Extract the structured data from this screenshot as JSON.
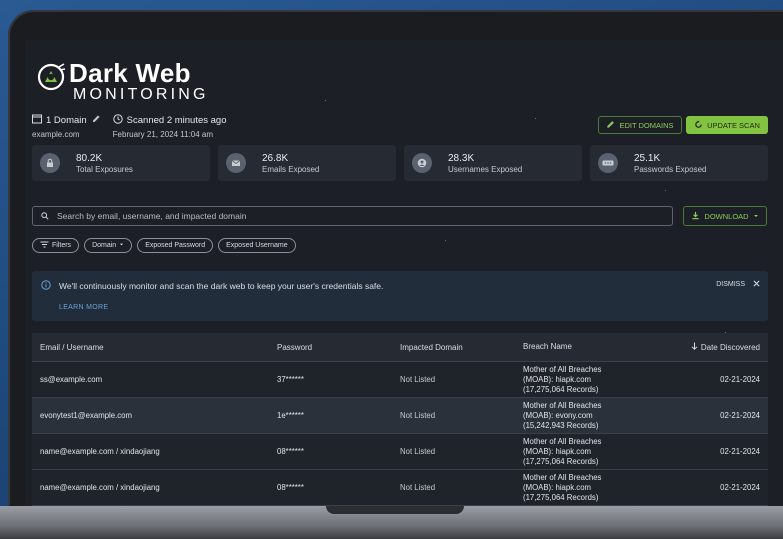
{
  "logo": {
    "line1": "Dark Web",
    "line2": "MONITORING"
  },
  "meta": {
    "domain_count": "1 Domain",
    "domain": "example.com",
    "scanned": "Scanned 2 minutes ago",
    "scanned_date": "February 21, 2024 11:04 am"
  },
  "actions": {
    "edit_domains": "EDIT DOMAINS",
    "update_scan": "UPDATE SCAN",
    "download": "DOWNLOAD"
  },
  "stats": [
    {
      "value": "80.2K",
      "label": "Total Exposures",
      "icon": "lock-icon"
    },
    {
      "value": "26.8K",
      "label": "Emails Exposed",
      "icon": "mail-icon"
    },
    {
      "value": "28.3K",
      "label": "Usernames Exposed",
      "icon": "user-icon"
    },
    {
      "value": "25.1K",
      "label": "Passwords Exposed",
      "icon": "password-icon"
    }
  ],
  "search": {
    "placeholder": "Search by email, username, and impacted domain"
  },
  "filters": {
    "filters": "Filters",
    "domain": "Domain",
    "exposed_password": "Exposed Password",
    "exposed_username": "Exposed Username"
  },
  "banner": {
    "message": "We'll continuously monitor and scan the dark web to keep your user's credentials safe.",
    "learn_more": "LEARN MORE",
    "dismiss": "DISMISS"
  },
  "table": {
    "headers": {
      "email": "Email / Username",
      "password": "Password",
      "domain": "Impacted Domain",
      "breach": "Breach Name",
      "date": "Date Discovered"
    },
    "rows": [
      {
        "email": "ss@example.com",
        "password": "37******",
        "domain": "Not Listed",
        "breach1": "Mother of All Breaches",
        "breach2": "(MOAB): hiapk.com",
        "breach3": "(17,275,064 Records)",
        "date": "02-21-2024"
      },
      {
        "email": "evonytest1@example.com",
        "password": "1e******",
        "domain": "Not Listed",
        "breach1": "Mother of All Breaches",
        "breach2": "(MOAB): evony.com",
        "breach3": "(15,242,943 Records)",
        "date": "02-21-2024"
      },
      {
        "email": "name@example.com / xindaojiang",
        "password": "08******",
        "domain": "Not Listed",
        "breach1": "Mother of All Breaches",
        "breach2": "(MOAB): hiapk.com",
        "breach3": "(17,275,064 Records)",
        "date": "02-21-2024"
      },
      {
        "email": "name@example.com / xindaojiang",
        "password": "08******",
        "domain": "Not Listed",
        "breach1": "Mother of All Breaches",
        "breach2": "(MOAB): hiapk.com",
        "breach3": "(17,275,064 Records)",
        "date": "02-21-2024"
      }
    ]
  },
  "colors": {
    "accent": "#82c341",
    "link": "#6aa0d8",
    "background": "#1c2026"
  }
}
